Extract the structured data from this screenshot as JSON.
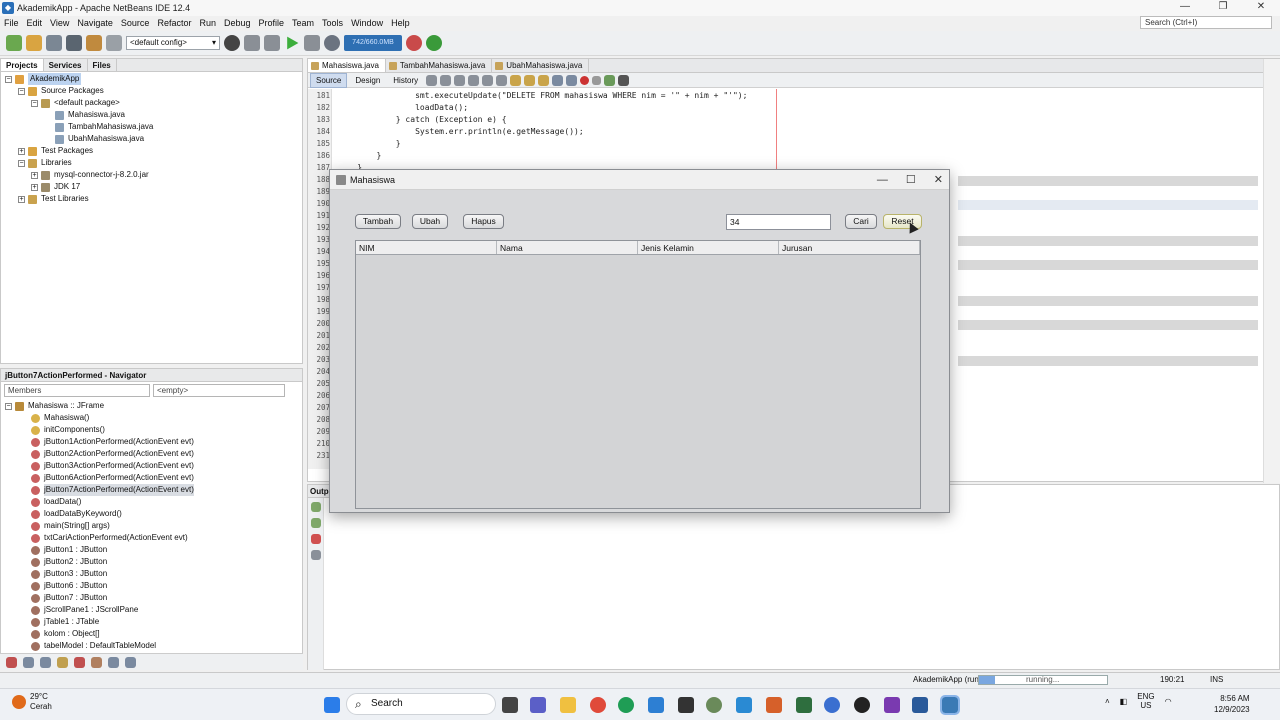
{
  "window": {
    "title": "AkademikApp - Apache NetBeans IDE 12.4"
  },
  "menu": [
    "File",
    "Edit",
    "View",
    "Navigate",
    "Source",
    "Refactor",
    "Run",
    "Debug",
    "Profile",
    "Team",
    "Tools",
    "Window",
    "Help"
  ],
  "top_search": {
    "placeholder": "Search (Ctrl+I)"
  },
  "toolbar": {
    "config": "<default config>",
    "memory": "742/660.0MB"
  },
  "projects": {
    "tabs": [
      "Projects",
      "Services",
      "Files"
    ],
    "tree": [
      "AkademikApp",
      "Source Packages",
      "<default package>",
      "Mahasiswa.java",
      "TambahMahasiswa.java",
      "UbahMahasiswa.java",
      "Test Packages",
      "Libraries",
      "mysql-connector-j-8.2.0.jar",
      "JDK 17",
      "Test Libraries"
    ]
  },
  "navigator": {
    "title": "jButton7ActionPerformed - Navigator",
    "filter": "Members",
    "empty": "<empty>",
    "root": "Mahasiswa :: JFrame",
    "members": [
      "Mahasiswa()",
      "initComponents()",
      "jButton1ActionPerformed(ActionEvent evt)",
      "jButton2ActionPerformed(ActionEvent evt)",
      "jButton3ActionPerformed(ActionEvent evt)",
      "jButton6ActionPerformed(ActionEvent evt)",
      "jButton7ActionPerformed(ActionEvent evt)",
      "loadData()",
      "loadDataByKeyword()",
      "main(String[] args)",
      "txtCariActionPerformed(ActionEvent evt)",
      "jButton1 : JButton",
      "jButton2 : JButton",
      "jButton3 : JButton",
      "jButton6 : JButton",
      "jButton7 : JButton",
      "jScrollPane1 : JScrollPane",
      "jTable1 : JTable",
      "kolom : Object[]",
      "tabelModel : DefaultTableModel"
    ]
  },
  "editor": {
    "tabs": [
      "Mahasiswa.java",
      "TambahMahasiswa.java",
      "UbahMahasiswa.java"
    ],
    "modes": [
      "Source",
      "Design",
      "History"
    ],
    "line_numbers": [
      "181",
      "182",
      "183",
      "184",
      "185",
      "186",
      "187",
      "188",
      "189",
      "190",
      "191",
      "192",
      "193",
      "194",
      "195",
      "196",
      "197",
      "198",
      "199",
      "200",
      "201",
      "202",
      "203",
      "204",
      "205",
      "206",
      "207",
      "208",
      "209",
      "210",
      "231"
    ],
    "code": [
      "                smt.executeUpdate(\"DELETE FROM mahasiswa WHERE nim = '\" + nim + \"'\");",
      "                loadData();",
      "            } catch (Exception e) {",
      "                System.err.println(e.getMessage());",
      "            }",
      "        }",
      "    }"
    ]
  },
  "output": {
    "label": "Outpu"
  },
  "status": {
    "run": "AkademikApp (run)",
    "progress": "running...",
    "position": "190:21",
    "mode": "INS"
  },
  "dialog": {
    "title": "Mahasiswa",
    "buttons": {
      "tambah": "Tambah",
      "ubah": "Ubah",
      "hapus": "Hapus",
      "cari": "Cari",
      "reset": "Reset"
    },
    "search_value": "34",
    "columns": [
      "NIM",
      "Nama",
      "Jenis Kelamin",
      "Jurusan"
    ]
  },
  "taskbar": {
    "temp": "29°C",
    "condition": "Cerah",
    "search": "Search",
    "lang": "ENG",
    "region": "US",
    "time": "8:56 AM",
    "date": "12/9/2023"
  }
}
